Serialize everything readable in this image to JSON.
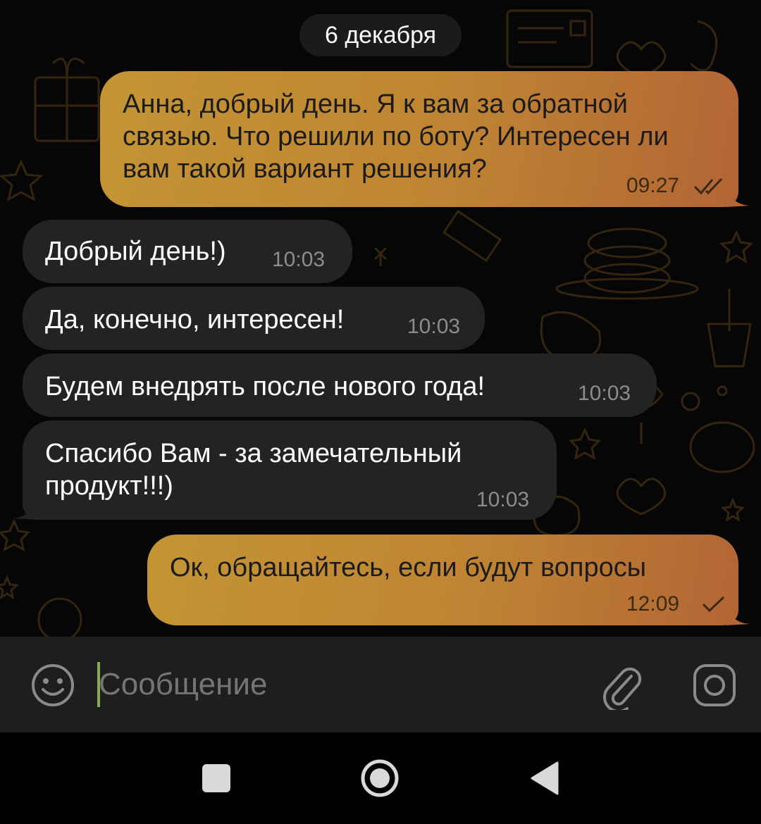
{
  "chat": {
    "date_separator": "6 декабря",
    "messages": [
      {
        "direction": "outgoing",
        "text": "Анна, добрый день. Я к вам за обратной связью. Что решили по боту? Интересен ли вам такой вариант решения?",
        "time": "09:27",
        "status": "read"
      },
      {
        "direction": "incoming",
        "text": "Добрый день!)",
        "time": "10:03"
      },
      {
        "direction": "incoming",
        "text": "Да, конечно, интересен!",
        "time": "10:03"
      },
      {
        "direction": "incoming",
        "text": "Будем внедрять после нового года!",
        "time": "10:03"
      },
      {
        "direction": "incoming",
        "text": "Спасибо Вам - за замечательный продукт!!!)",
        "time": "10:03"
      },
      {
        "direction": "outgoing",
        "text": "Ок, обращайтесь, если будут вопросы",
        "time": "12:09",
        "status": "sent"
      }
    ]
  },
  "input": {
    "placeholder": "Сообщение",
    "emoji_icon": "emoji-icon",
    "attach_icon": "paperclip-icon",
    "camera_icon": "camera-icon"
  },
  "navbar": {
    "recents_icon": "square-icon",
    "home_icon": "circle-icon",
    "back_icon": "triangle-back-icon"
  },
  "colors": {
    "outgoing_bubble_start": "#c49534",
    "outgoing_bubble_end": "#b26535",
    "incoming_bubble": "#232323",
    "background": "#060606",
    "input_bar": "#1e1e1e",
    "cursor": "#86ad4e"
  }
}
